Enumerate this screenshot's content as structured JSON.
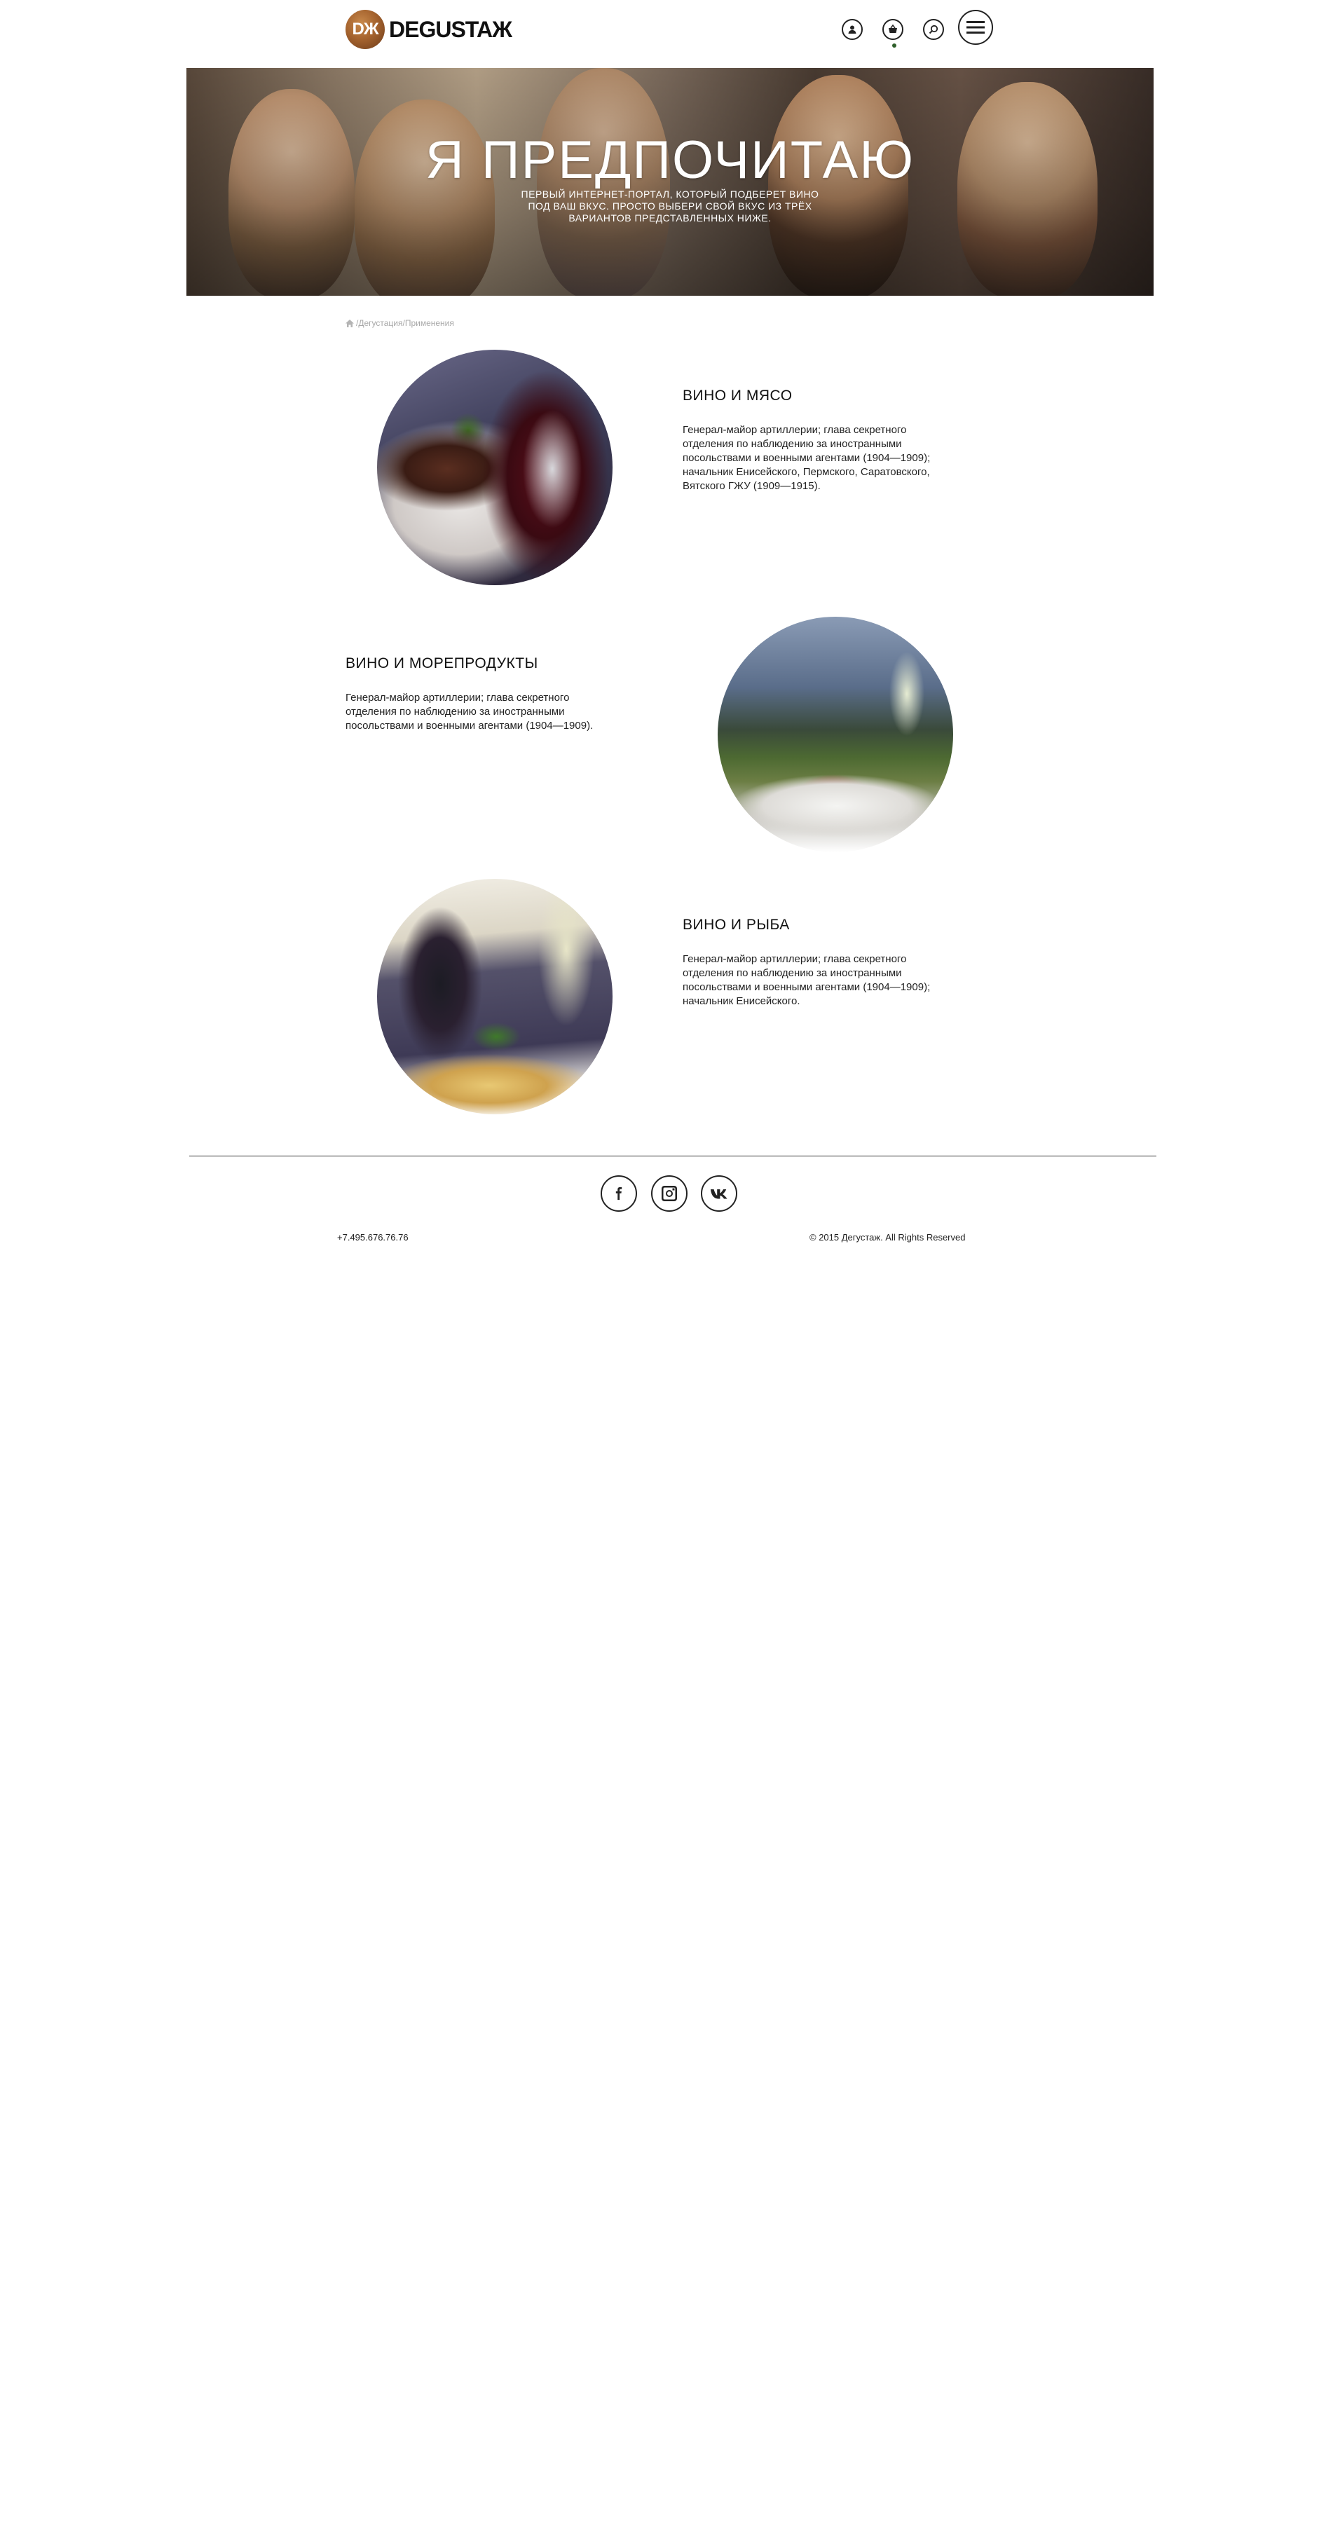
{
  "header": {
    "logo_mark": "DЖ",
    "logo_text": "DEGUSTAЖ",
    "icons": [
      "user-icon",
      "basket-icon",
      "search-icon",
      "menu-icon"
    ]
  },
  "hero": {
    "title": "Я ПРЕДПОЧИТАЮ",
    "subtitle_lines": [
      "ПЕРВЫЙ ИНТЕРНЕТ-ПОРТАЛ, КОТОРЫЙ ПОДБЕРЕТ ВИНО",
      "ПОД ВАШ ВКУС. ПРОСТО ВЫБЕРИ СВОЙ ВКУС ИЗ ТРЁХ",
      "ВАРИАНТОВ ПРЕДСТАВЛЕННЫХ НИЖЕ."
    ]
  },
  "breadcrumb": {
    "path": "/Дегустация/Применения"
  },
  "sections": [
    {
      "title": "ВИНО И МЯСО",
      "text_lines": [
        "Генерал-майор артиллерии; глава секретного",
        "отделения по наблюдению за иностранными",
        "посольствами и военными агентами (1904—1909);",
        "начальник Енисейского, Пермского, Саратовского,",
        "Вятского ГЖУ (1909—1915)."
      ]
    },
    {
      "title": "ВИНО И МОРЕПРОДУКТЫ",
      "text_lines": [
        "Генерал-майор артиллерии; глава секретного",
        "отделения по наблюдению за иностранными",
        "посольствами и военными агентами (1904—1909)."
      ]
    },
    {
      "title": "ВИНО И РЫБА",
      "text_lines": [
        "Генерал-майор артиллерии; глава секретного",
        "отделения по наблюдению за иностранными",
        "посольствами и военными агентами (1904—1909);",
        "начальник Енисейского."
      ]
    }
  ],
  "footer": {
    "phone": "+7.495.676.76.76",
    "copyright": "© 2015 Дегустаж. All Rights Reserved",
    "social": [
      "facebook-icon",
      "instagram-icon",
      "vk-icon"
    ]
  },
  "colors": {
    "accent_dot": "#2f5f2b",
    "text": "#1b1b1b",
    "breadcrumb": "#a8a8a8"
  }
}
